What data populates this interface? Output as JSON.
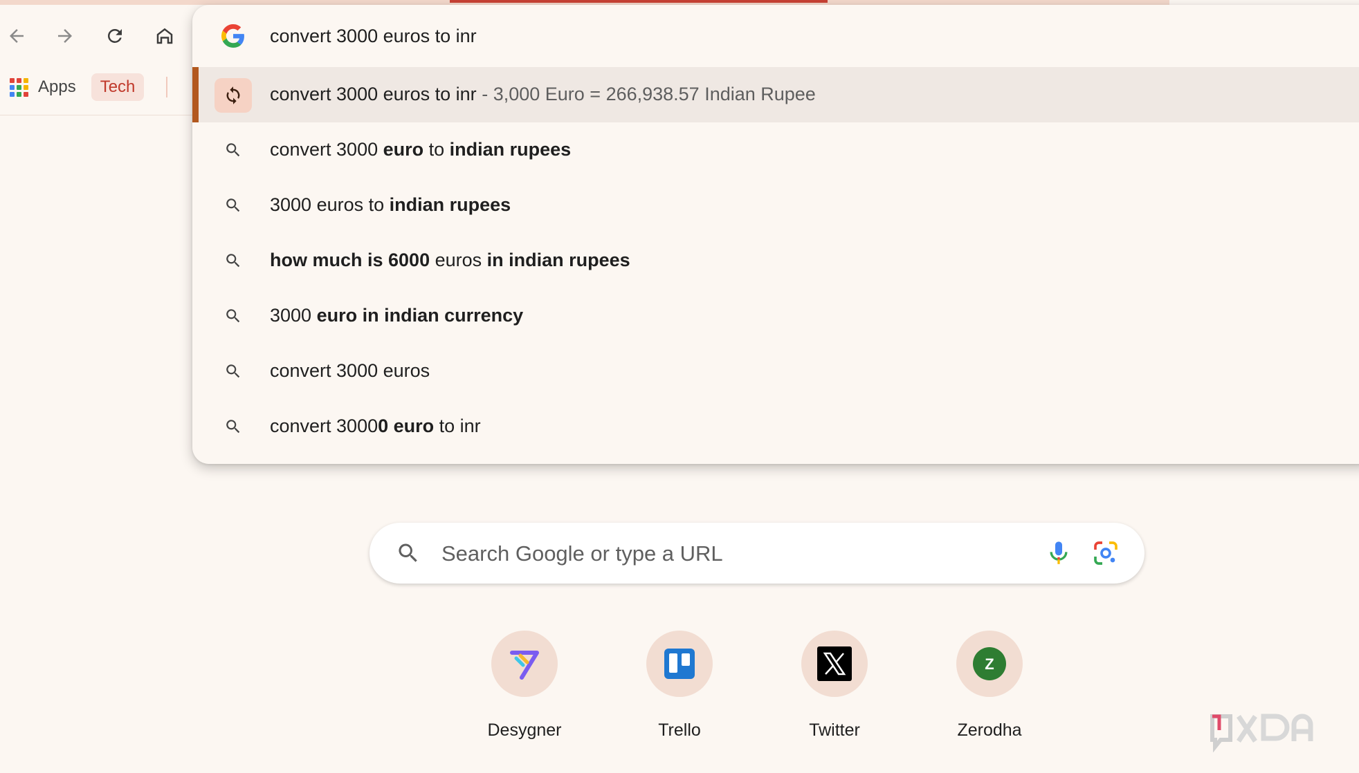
{
  "toolbar": {
    "bookmarks": {
      "apps_label": "Apps",
      "tech_label": "Tech"
    }
  },
  "omnibox": {
    "query": "convert 3000 euros to inr",
    "suggestions": [
      {
        "type": "conversion",
        "text": "convert 3000 euros to inr",
        "answer": "- 3,000 Euro = 266,938.57 Indian Rupee",
        "selected": true
      },
      {
        "type": "search",
        "segments": [
          {
            "t": "convert 3000 ",
            "b": false
          },
          {
            "t": "euro",
            "b": true
          },
          {
            "t": " to ",
            "b": false
          },
          {
            "t": "indian rupees",
            "b": true
          }
        ]
      },
      {
        "type": "search",
        "segments": [
          {
            "t": "3000 euros to ",
            "b": false
          },
          {
            "t": "indian rupees",
            "b": true
          }
        ]
      },
      {
        "type": "search",
        "segments": [
          {
            "t": "how much is 6000",
            "b": true
          },
          {
            "t": " euros ",
            "b": false
          },
          {
            "t": "in indian rupees",
            "b": true
          }
        ]
      },
      {
        "type": "search",
        "segments": [
          {
            "t": "3000 ",
            "b": false
          },
          {
            "t": "euro in indian currency",
            "b": true
          }
        ]
      },
      {
        "type": "search",
        "segments": [
          {
            "t": "convert 3000 euros",
            "b": false
          }
        ]
      },
      {
        "type": "search",
        "segments": [
          {
            "t": "convert 3000",
            "b": false
          },
          {
            "t": "0 euro",
            "b": true
          },
          {
            "t": " to inr",
            "b": false
          }
        ]
      }
    ]
  },
  "search": {
    "placeholder": "Search Google or type a URL"
  },
  "shortcuts": [
    {
      "label": "Desygner",
      "icon": "desygner-icon"
    },
    {
      "label": "Trello",
      "icon": "trello-icon"
    },
    {
      "label": "Twitter",
      "icon": "x-logo-icon"
    },
    {
      "label": "Zerodha",
      "icon": "zerodha-icon",
      "letter": "Z"
    }
  ],
  "colors": {
    "background": "#fcf7f2",
    "accent": "#b2581e",
    "loading_bar": "#c84235",
    "tech_chip_text": "#c0392b"
  }
}
